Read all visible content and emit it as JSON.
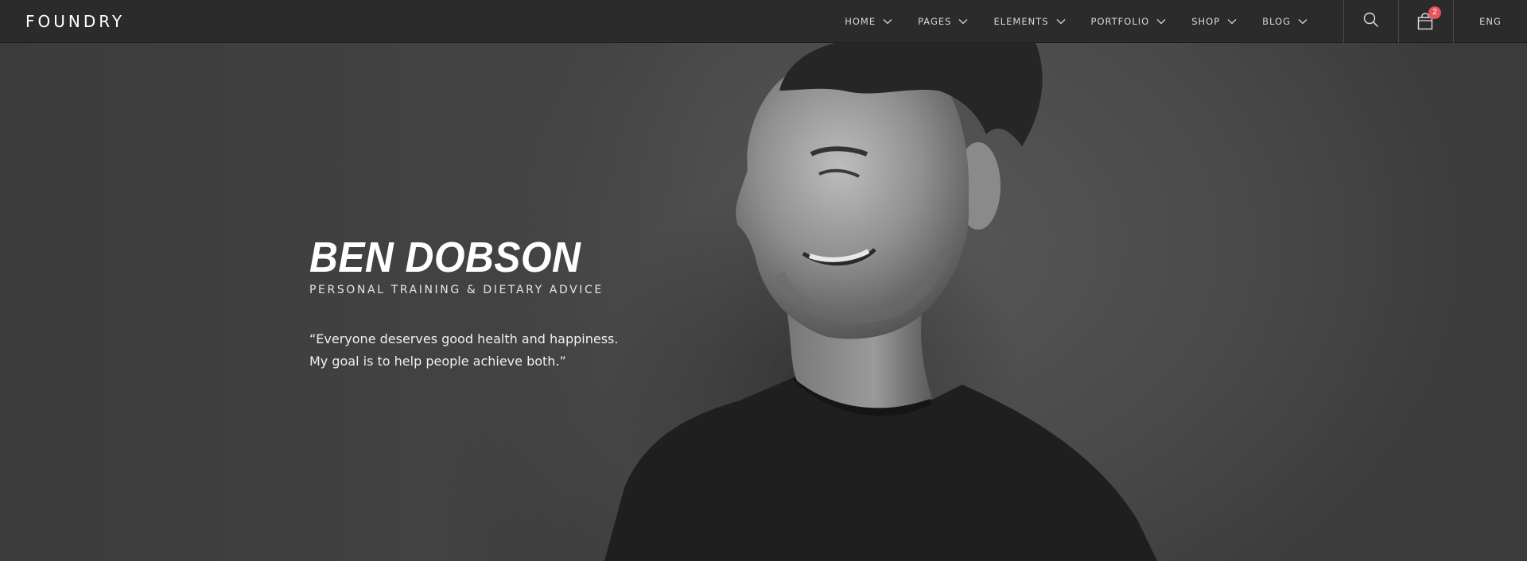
{
  "nav": {
    "logo": "FOUNDRY",
    "items": [
      {
        "label": "HOME"
      },
      {
        "label": "PAGES"
      },
      {
        "label": "ELEMENTS"
      },
      {
        "label": "PORTFOLIO"
      },
      {
        "label": "SHOP"
      },
      {
        "label": "BLOG"
      }
    ],
    "search_icon": "search-icon",
    "cart_icon": "shopping-bag-icon",
    "cart_count": "2",
    "language": "ENG"
  },
  "hero": {
    "name": "BEN DOBSON",
    "subtitle": "PERSONAL TRAINING & DIETARY ADVICE",
    "quote_line1": "“Everyone deserves good health and happiness.",
    "quote_line2": "My goal is to help people achieve both.”"
  },
  "colors": {
    "navbar_bg": "#2b2b2b",
    "badge": "#e8545a",
    "hero_bg": "#3b3b3b"
  }
}
